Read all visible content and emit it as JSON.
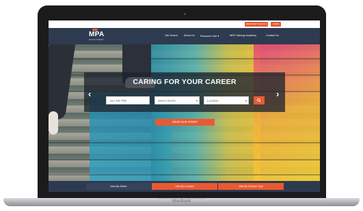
{
  "device": {
    "brand_label": "MacBook"
  },
  "topbar": {
    "buttons": [
      "REGISTER YOUR CV",
      "LOGIN"
    ]
  },
  "nav": {
    "logo_main": "MPA",
    "logo_sub": "RECRUITMENT",
    "links": [
      "Job Search",
      "About Us",
      "Resource Hub",
      "MPA Training Academy",
      "Contact Us"
    ]
  },
  "hero": {
    "title": "CARING FOR YOUR CAREER",
    "search": {
      "job_title_placeholder": "Any Job Title",
      "sector_value": "Select Sector",
      "location_value": "Location",
      "search_icon": "search-icon"
    },
    "story_button": "HEAR OUR STORY",
    "prev_icon": "‹",
    "next_icon": "›"
  },
  "bottom_tabs": [
    "Jobs By Sector",
    "Jobs By Location",
    "Jobs By Contract Type"
  ],
  "colors": {
    "accent": "#e85a33",
    "nav": "#2e3a4f",
    "bezel": "#1b1b1d"
  }
}
